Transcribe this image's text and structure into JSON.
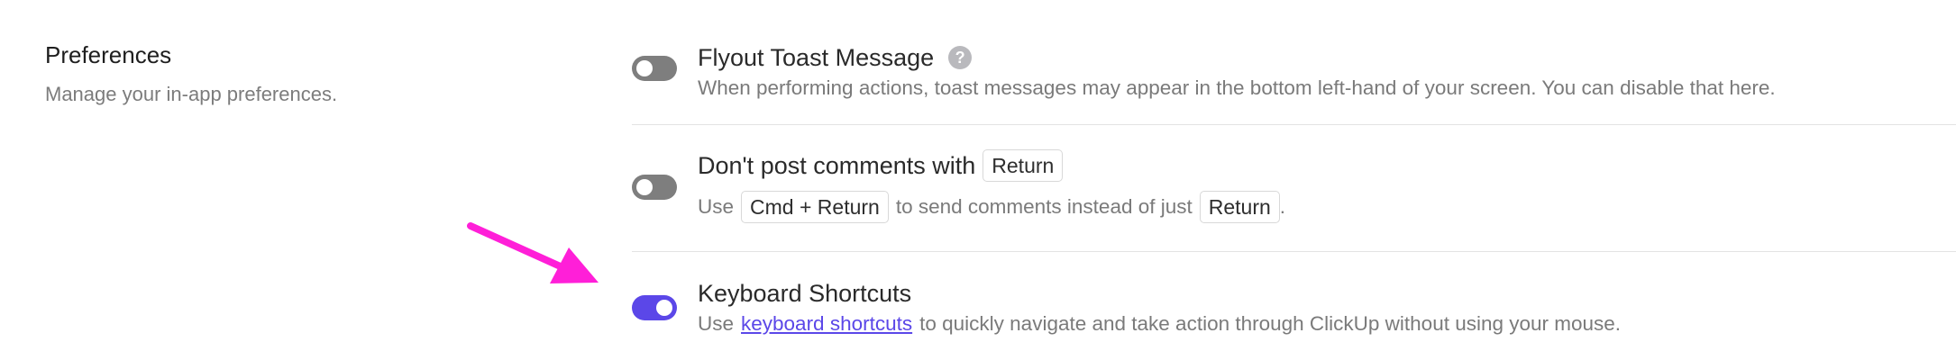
{
  "section": {
    "title": "Preferences",
    "subtitle": "Manage your in-app preferences."
  },
  "settings": [
    {
      "title": "Flyout Toast Message",
      "description": "When performing actions, toast messages may appear in the bottom left-hand of your screen. You can disable that here.",
      "enabled": false,
      "help_icon": "question-mark-icon"
    },
    {
      "title": "Don't post comments with",
      "title_key": "Return",
      "description_prefix": "Use",
      "description_key_1": "Cmd + Return",
      "description_middle": "to send comments instead of just",
      "description_key_2": "Return",
      "description_suffix": ".",
      "enabled": false
    },
    {
      "title": "Keyboard Shortcuts",
      "description_prefix": "Use",
      "description_link": "keyboard shortcuts",
      "description_suffix": "to quickly navigate and take action through ClickUp without using your mouse.",
      "enabled": true
    }
  ],
  "colors": {
    "toggle_on": "#5b47e8",
    "toggle_off": "#7e7e7e",
    "annotation_arrow": "#ff1fd8",
    "link": "#5b47e8"
  }
}
